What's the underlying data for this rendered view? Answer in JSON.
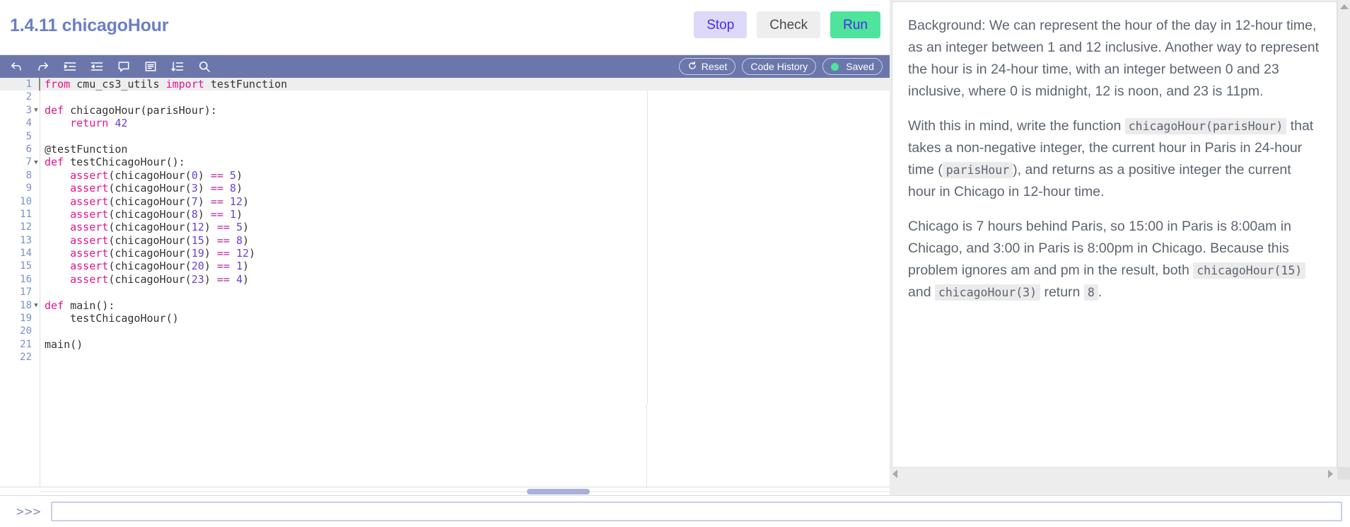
{
  "header": {
    "title": "1.4.11 chicagoHour",
    "buttons": [
      {
        "label": "Stop",
        "name": "stop-button",
        "color": "#ddd9f8"
      },
      {
        "label": "Check",
        "name": "check-button",
        "color": "#eeeeee"
      },
      {
        "label": "Run",
        "name": "run-button",
        "color": "#4ee49b"
      }
    ]
  },
  "editor_toolbar": {
    "icons": [
      {
        "name": "undo-icon",
        "title": "Undo"
      },
      {
        "name": "redo-icon",
        "title": "Redo"
      },
      {
        "name": "indent-icon",
        "title": "Indent"
      },
      {
        "name": "dedent-icon",
        "title": "Dedent"
      },
      {
        "name": "comment-icon",
        "title": "Comment"
      },
      {
        "name": "format-lines-icon",
        "title": "Format"
      },
      {
        "name": "sort-lines-icon",
        "title": "Sort Lines"
      },
      {
        "name": "search-icon",
        "title": "Search"
      }
    ],
    "reset_label": "Reset",
    "reset_icon": "refresh-icon",
    "code_history_label": "Code History",
    "saved_label": "Saved",
    "saved_dot_color": "#4ee49b"
  },
  "code": {
    "active_line": 1,
    "lines": [
      {
        "n": "1",
        "fold": false,
        "tokens": [
          {
            "t": "from",
            "c": "kw"
          },
          {
            "t": " cmu_cs3_utils ",
            "c": "pl"
          },
          {
            "t": "import",
            "c": "kw"
          },
          {
            "t": " testFunction",
            "c": "pl"
          }
        ]
      },
      {
        "n": "2",
        "fold": false,
        "tokens": []
      },
      {
        "n": "3",
        "fold": true,
        "tokens": [
          {
            "t": "def",
            "c": "kw"
          },
          {
            "t": " chicagoHour(parisHour):",
            "c": "pl"
          }
        ]
      },
      {
        "n": "4",
        "fold": false,
        "tokens": [
          {
            "t": "    ",
            "c": "pl"
          },
          {
            "t": "return",
            "c": "kw"
          },
          {
            "t": " ",
            "c": "pl"
          },
          {
            "t": "42",
            "c": "num"
          }
        ]
      },
      {
        "n": "5",
        "fold": false,
        "tokens": []
      },
      {
        "n": "6",
        "fold": false,
        "tokens": [
          {
            "t": "@testFunction",
            "c": "dec"
          }
        ]
      },
      {
        "n": "7",
        "fold": true,
        "tokens": [
          {
            "t": "def",
            "c": "kw"
          },
          {
            "t": " testChicagoHour():",
            "c": "pl"
          }
        ]
      },
      {
        "n": "8",
        "fold": false,
        "tokens": [
          {
            "t": "    ",
            "c": "pl"
          },
          {
            "t": "assert",
            "c": "fn"
          },
          {
            "t": "(chicagoHour(",
            "c": "pl"
          },
          {
            "t": "0",
            "c": "num"
          },
          {
            "t": ") ",
            "c": "pl"
          },
          {
            "t": "==",
            "c": "op"
          },
          {
            "t": " ",
            "c": "pl"
          },
          {
            "t": "5",
            "c": "num"
          },
          {
            "t": ")",
            "c": "pl"
          }
        ]
      },
      {
        "n": "9",
        "fold": false,
        "tokens": [
          {
            "t": "    ",
            "c": "pl"
          },
          {
            "t": "assert",
            "c": "fn"
          },
          {
            "t": "(chicagoHour(",
            "c": "pl"
          },
          {
            "t": "3",
            "c": "num"
          },
          {
            "t": ") ",
            "c": "pl"
          },
          {
            "t": "==",
            "c": "op"
          },
          {
            "t": " ",
            "c": "pl"
          },
          {
            "t": "8",
            "c": "num"
          },
          {
            "t": ")",
            "c": "pl"
          }
        ]
      },
      {
        "n": "10",
        "fold": false,
        "tokens": [
          {
            "t": "    ",
            "c": "pl"
          },
          {
            "t": "assert",
            "c": "fn"
          },
          {
            "t": "(chicagoHour(",
            "c": "pl"
          },
          {
            "t": "7",
            "c": "num"
          },
          {
            "t": ") ",
            "c": "pl"
          },
          {
            "t": "==",
            "c": "op"
          },
          {
            "t": " ",
            "c": "pl"
          },
          {
            "t": "12",
            "c": "num"
          },
          {
            "t": ")",
            "c": "pl"
          }
        ]
      },
      {
        "n": "11",
        "fold": false,
        "tokens": [
          {
            "t": "    ",
            "c": "pl"
          },
          {
            "t": "assert",
            "c": "fn"
          },
          {
            "t": "(chicagoHour(",
            "c": "pl"
          },
          {
            "t": "8",
            "c": "num"
          },
          {
            "t": ") ",
            "c": "pl"
          },
          {
            "t": "==",
            "c": "op"
          },
          {
            "t": " ",
            "c": "pl"
          },
          {
            "t": "1",
            "c": "num"
          },
          {
            "t": ")",
            "c": "pl"
          }
        ]
      },
      {
        "n": "12",
        "fold": false,
        "tokens": [
          {
            "t": "    ",
            "c": "pl"
          },
          {
            "t": "assert",
            "c": "fn"
          },
          {
            "t": "(chicagoHour(",
            "c": "pl"
          },
          {
            "t": "12",
            "c": "num"
          },
          {
            "t": ") ",
            "c": "pl"
          },
          {
            "t": "==",
            "c": "op"
          },
          {
            "t": " ",
            "c": "pl"
          },
          {
            "t": "5",
            "c": "num"
          },
          {
            "t": ")",
            "c": "pl"
          }
        ]
      },
      {
        "n": "13",
        "fold": false,
        "tokens": [
          {
            "t": "    ",
            "c": "pl"
          },
          {
            "t": "assert",
            "c": "fn"
          },
          {
            "t": "(chicagoHour(",
            "c": "pl"
          },
          {
            "t": "15",
            "c": "num"
          },
          {
            "t": ") ",
            "c": "pl"
          },
          {
            "t": "==",
            "c": "op"
          },
          {
            "t": " ",
            "c": "pl"
          },
          {
            "t": "8",
            "c": "num"
          },
          {
            "t": ")",
            "c": "pl"
          }
        ]
      },
      {
        "n": "14",
        "fold": false,
        "tokens": [
          {
            "t": "    ",
            "c": "pl"
          },
          {
            "t": "assert",
            "c": "fn"
          },
          {
            "t": "(chicagoHour(",
            "c": "pl"
          },
          {
            "t": "19",
            "c": "num"
          },
          {
            "t": ") ",
            "c": "pl"
          },
          {
            "t": "==",
            "c": "op"
          },
          {
            "t": " ",
            "c": "pl"
          },
          {
            "t": "12",
            "c": "num"
          },
          {
            "t": ")",
            "c": "pl"
          }
        ]
      },
      {
        "n": "15",
        "fold": false,
        "tokens": [
          {
            "t": "    ",
            "c": "pl"
          },
          {
            "t": "assert",
            "c": "fn"
          },
          {
            "t": "(chicagoHour(",
            "c": "pl"
          },
          {
            "t": "20",
            "c": "num"
          },
          {
            "t": ") ",
            "c": "pl"
          },
          {
            "t": "==",
            "c": "op"
          },
          {
            "t": " ",
            "c": "pl"
          },
          {
            "t": "1",
            "c": "num"
          },
          {
            "t": ")",
            "c": "pl"
          }
        ]
      },
      {
        "n": "16",
        "fold": false,
        "tokens": [
          {
            "t": "    ",
            "c": "pl"
          },
          {
            "t": "assert",
            "c": "fn"
          },
          {
            "t": "(chicagoHour(",
            "c": "pl"
          },
          {
            "t": "23",
            "c": "num"
          },
          {
            "t": ") ",
            "c": "pl"
          },
          {
            "t": "==",
            "c": "op"
          },
          {
            "t": " ",
            "c": "pl"
          },
          {
            "t": "4",
            "c": "num"
          },
          {
            "t": ")",
            "c": "pl"
          }
        ]
      },
      {
        "n": "17",
        "fold": false,
        "tokens": []
      },
      {
        "n": "18",
        "fold": true,
        "tokens": [
          {
            "t": "def",
            "c": "kw"
          },
          {
            "t": " main():",
            "c": "pl"
          }
        ]
      },
      {
        "n": "19",
        "fold": false,
        "tokens": [
          {
            "t": "    testChicagoHour()",
            "c": "pl"
          }
        ]
      },
      {
        "n": "20",
        "fold": false,
        "tokens": []
      },
      {
        "n": "21",
        "fold": false,
        "tokens": [
          {
            "t": "main()",
            "c": "pl"
          }
        ]
      },
      {
        "n": "22",
        "fold": false,
        "tokens": []
      }
    ]
  },
  "console": {
    "prompt": ">>>",
    "value": "",
    "placeholder": ""
  },
  "instructions": {
    "paragraphs": [
      {
        "parts": [
          {
            "type": "text",
            "value": "Background: We can represent the hour of the day in 12-hour time, as an integer between 1 and 12 inclusive. Another way to represent the hour is in 24-hour time, with an integer between 0 and 23 inclusive, where 0 is midnight, 12 is noon, and 23 is 11pm."
          }
        ]
      },
      {
        "parts": [
          {
            "type": "text",
            "value": "With this in mind, write the function "
          },
          {
            "type": "code",
            "value": "chicagoHour(parisHour)"
          },
          {
            "type": "text",
            "value": " that takes a non-negative integer, the current hour in Paris in 24-hour time ("
          },
          {
            "type": "code",
            "value": "parisHour"
          },
          {
            "type": "text",
            "value": "), and returns as a positive integer the current hour in Chicago in 12-hour time."
          }
        ]
      },
      {
        "parts": [
          {
            "type": "text",
            "value": "Chicago is 7 hours behind Paris, so 15:00 in Paris is 8:00am in Chicago, and 3:00 in Paris is 8:00pm in Chicago. Because this problem ignores am and pm in the result, both "
          },
          {
            "type": "code",
            "value": "chicagoHour(15)"
          },
          {
            "type": "text",
            "value": " and "
          },
          {
            "type": "code",
            "value": "chicagoHour(3)"
          },
          {
            "type": "text",
            "value": " return "
          },
          {
            "type": "code",
            "value": "8"
          },
          {
            "type": "text",
            "value": "."
          }
        ]
      }
    ]
  },
  "colors": {
    "toolbar_purple": "#6b77ab",
    "title_blue": "#6b7fc7",
    "run_green": "#4ee49b",
    "stop_lavender": "#ddd9f8",
    "accent_violet": "#4a2ce8",
    "keyword_pink": "#e5148d",
    "number_purple": "#6b3fd4"
  }
}
